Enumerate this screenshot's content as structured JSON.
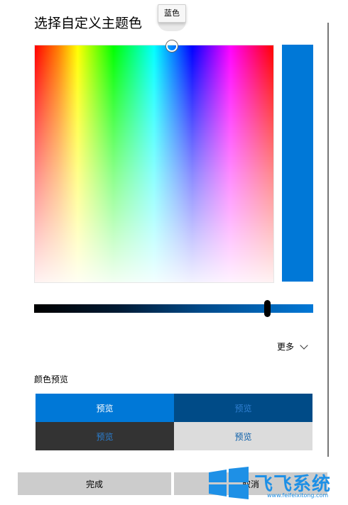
{
  "dialog": {
    "title": "选择自定义主题色",
    "tooltip": "蓝色",
    "selected_color": "#0078d7",
    "more_label": "更多",
    "preview_label": "颜色预览",
    "preview_cells": [
      "预览",
      "预览",
      "预览",
      "预览"
    ],
    "buttons": {
      "done": "完成",
      "cancel": "取消"
    }
  },
  "watermark": {
    "brand": "飞飞系统",
    "url": "www.feifeixitong.com"
  },
  "colors": {
    "accent": "#0078d7",
    "dark_accent": "#004b87",
    "dark_cell": "#333333",
    "light_cell": "#dcdcdc"
  }
}
